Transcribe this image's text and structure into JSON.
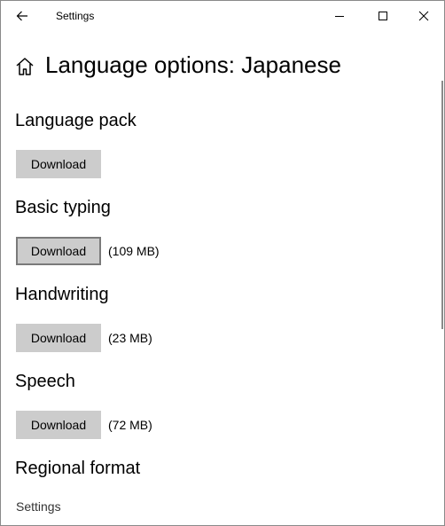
{
  "window": {
    "title": "Settings"
  },
  "header": {
    "title": "Language options: Japanese"
  },
  "sections": [
    {
      "title": "Language pack",
      "button_label": "Download",
      "size": ""
    },
    {
      "title": "Basic typing",
      "button_label": "Download",
      "size": "(109 MB)"
    },
    {
      "title": "Handwriting",
      "button_label": "Download",
      "size": "(23 MB)"
    },
    {
      "title": "Speech",
      "button_label": "Download",
      "size": "(72 MB)"
    },
    {
      "title": "Regional format"
    }
  ],
  "regional_format": {
    "link_label": "Settings"
  },
  "icons": {
    "back": "back-arrow-icon",
    "home": "home-icon",
    "minimize": "minimize-icon",
    "maximize": "maximize-icon",
    "close": "close-icon"
  },
  "colors": {
    "button_bg": "#cccccc",
    "focus_border": "#7a7a7a",
    "window_border": "#8a8a8a"
  }
}
